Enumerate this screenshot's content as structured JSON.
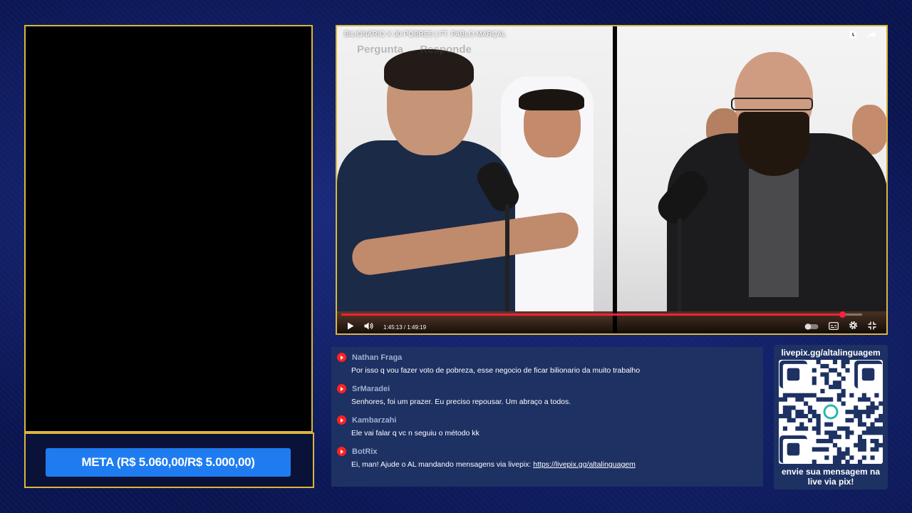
{
  "meta": {
    "label": "META (R$ 5.060,00/R$ 5.000,00)"
  },
  "video": {
    "title": "BILIONÁRIO X 30 POBRES | FT. PABLO MARÇAL",
    "watermark": "Pergunta → Responde",
    "time_current": "1:45:13",
    "time_total": "1:49:19",
    "time_display": "1:45:13 / 1:49:19",
    "progress": 0.962
  },
  "chat": {
    "messages": [
      {
        "author": "Nathan Fraga",
        "text": "Por isso q vou fazer voto de pobreza, esse negocio de ficar bilionario da muito trabalho"
      },
      {
        "author": "SrMaradei",
        "text": "Senhores, foi um prazer. Eu preciso repousar. Um abraço a todos."
      },
      {
        "author": "Kambarzahi",
        "text": "Ele vai falar q vc n seguiu o método kk"
      },
      {
        "author": "BotRix",
        "text": "Ei, man! Ajude o AL mandando mensagens via livepix: ",
        "link": "https://livepix.gg/altalinguagem"
      }
    ]
  },
  "pix": {
    "url": "livepix.gg/altalinguagem",
    "caption_line1": "envie sua mensagem na",
    "caption_line2": "live via pix!"
  },
  "colors": {
    "frame_border": "#d9b640",
    "meta_bar": "#1e7cf0",
    "chat_bg": "#1d3163",
    "progress": "#ff1f3a"
  }
}
